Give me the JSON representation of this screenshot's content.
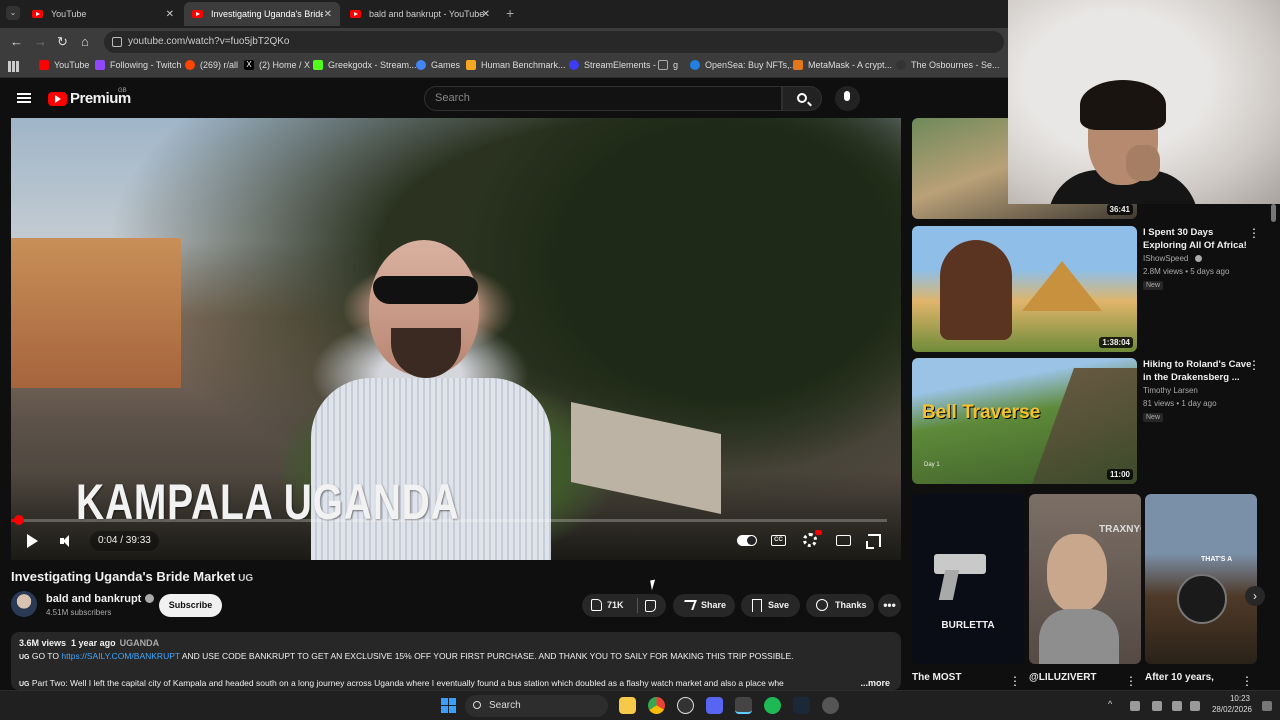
{
  "browser": {
    "tabs": [
      {
        "title": "YouTube"
      },
      {
        "title": "Investigating Uganda's Bride M"
      },
      {
        "title": "bald and bankrupt - YouTube"
      }
    ],
    "url": "youtube.com/watch?v=fuo5jbT2QKo",
    "bookmarks": [
      {
        "label": "YouTube",
        "color": "#ff0000"
      },
      {
        "label": "Following - Twitch",
        "color": "#9146ff"
      },
      {
        "label": "(269) r/all",
        "color": "#ff4500"
      },
      {
        "label": "(2) Home / X",
        "color": "#000000"
      },
      {
        "label": "Greekgodx - Stream...",
        "color": "#53fc18"
      },
      {
        "label": "Games",
        "color": "#4285f4"
      },
      {
        "label": "Human Benchmark...",
        "color": "#f5a623"
      },
      {
        "label": "StreamElements -",
        "color": "#3e3bf5"
      },
      {
        "label": "g",
        "color": "#888888"
      },
      {
        "label": "OpenSea: Buy NFTs,...",
        "color": "#2081e2"
      },
      {
        "label": "MetaMask - A crypt...",
        "color": "#e2761b"
      },
      {
        "label": "The Osbournes - Se...",
        "color": "#333333"
      }
    ]
  },
  "youtube": {
    "logo": "Premium",
    "logo_region": "GB",
    "search_placeholder": "Search"
  },
  "player": {
    "overlay_text": "KAMPALA UGANDA",
    "time": "0:04 / 39:33",
    "progress_fraction": 0.0017
  },
  "video": {
    "title": "Investigating Uganda's Bride Market",
    "title_flag": "UG",
    "channel": "bald and bankrupt",
    "subscribers": "4.51M subscribers",
    "subscribe_label": "Subscribe",
    "likes": "71K",
    "share_label": "Share",
    "save_label": "Save",
    "thanks_label": "Thanks",
    "more_label": "•••"
  },
  "description": {
    "views": "3.6M views",
    "age": "1 year ago",
    "tag": "UGANDA",
    "line1_flag": "UG",
    "line1_pre": "GO TO",
    "line1_link": "https://SAILY.COM/BANKRUPT",
    "line1_post": "AND USE CODE BANKRUPT TO GET AN EXCLUSIVE 15% OFF YOUR FIRST PURCHASE. AND THANK YOU TO SAILY FOR MAKING THIS TRIP POSSIBLE.",
    "line2_flag": "UG",
    "line2": "Part Two: Well I left the capital city of Kampala and headed south on a long journey across Uganda where I eventually found a bus station which doubled as a flashy watch market and also a place whe",
    "more": "...more"
  },
  "recommendations": [
    {
      "duration": "36:41"
    },
    {
      "title": "I Spent 30 Days Exploring All Of Africa!",
      "channel": "IShowSpeed",
      "meta": "2.8M views • 5 days ago",
      "badge": "New",
      "duration": "1:38:04"
    },
    {
      "title": "Hiking to Roland's Cave in the Drakensberg ...",
      "channel": "Timothy Larsen",
      "meta": "81 views • 1 day ago",
      "badge": "New",
      "duration": "11:00",
      "thumb_text": "Bell Traverse",
      "thumb_day": "Day 1"
    }
  ],
  "shorts": [
    {
      "title": "The MOST",
      "thumb_text": "BURLETTA"
    },
    {
      "title": "@LILUZIVERT",
      "thumb_text": "TRAXNYC"
    },
    {
      "title": "After 10 years,",
      "thumb_text": "THAT'S A"
    }
  ],
  "taskbar": {
    "search": "Search",
    "time": "10:23",
    "date": "28/02/2026"
  }
}
